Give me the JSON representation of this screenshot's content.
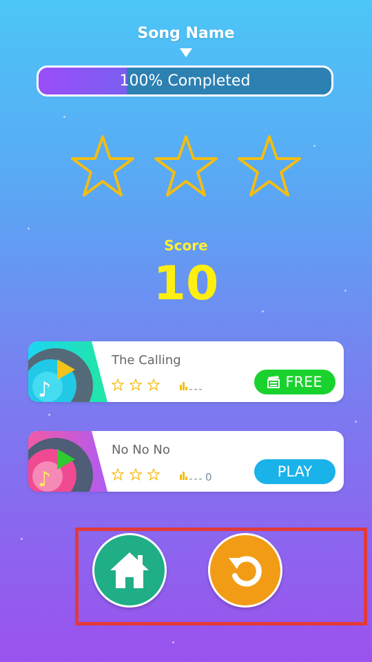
{
  "song": {
    "name": "Song Name",
    "progress_text": "100% Completed",
    "stars_earned": 0,
    "stars_total": 3
  },
  "score": {
    "label": "Score",
    "value": "10"
  },
  "songs_list": [
    {
      "title": "The Calling",
      "stars": 0,
      "rank": "",
      "button_label": "FREE",
      "button_icon": "clapperboard-icon",
      "accent": "#f4c21a"
    },
    {
      "title": "No No No",
      "stars": 0,
      "rank": "0",
      "button_label": "PLAY",
      "button_icon": "",
      "accent": "#2ecb31"
    }
  ],
  "controls": {
    "home_icon": "home-icon",
    "replay_icon": "replay-icon"
  },
  "colors": {
    "star_outline": "#f3bd14",
    "score": "#ffef10",
    "free_button": "#1ad22e",
    "play_button": "#19b2e9",
    "home_button": "#1fae86",
    "replay_button": "#f29c16",
    "highlight": "#e23a3a"
  }
}
